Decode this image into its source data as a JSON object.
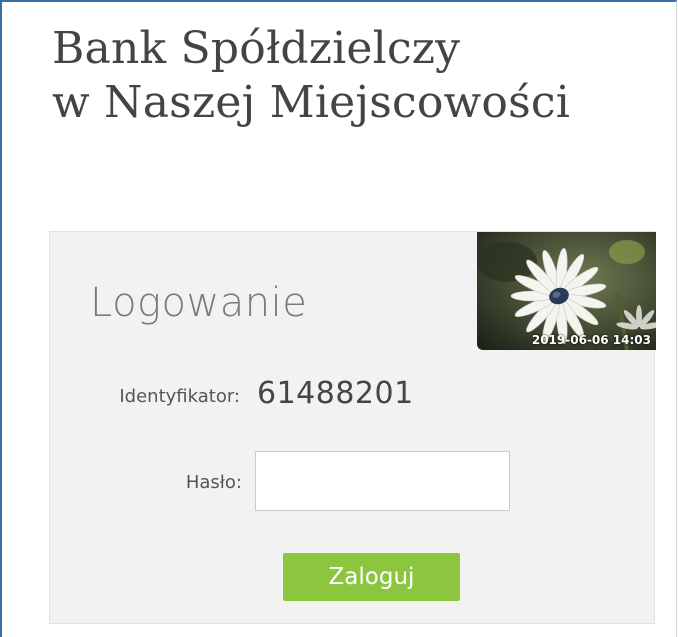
{
  "bank": {
    "name_line1": "Bank Spółdzielczy",
    "name_line2": "w Naszej Miejscowości"
  },
  "login": {
    "heading": "Logowanie",
    "identifier_label": "Identyfikator:",
    "identifier_value": "61488201",
    "password_label": "Hasło:",
    "password_value": "",
    "submit_label": "Zaloguj"
  },
  "security_image": {
    "subject": "daisy-flower",
    "timestamp": "2019-06-06 14:03"
  },
  "colors": {
    "accent_border": "#3a6ea5",
    "button": "#8cc63f",
    "panel_bg": "#f2f2f2"
  }
}
